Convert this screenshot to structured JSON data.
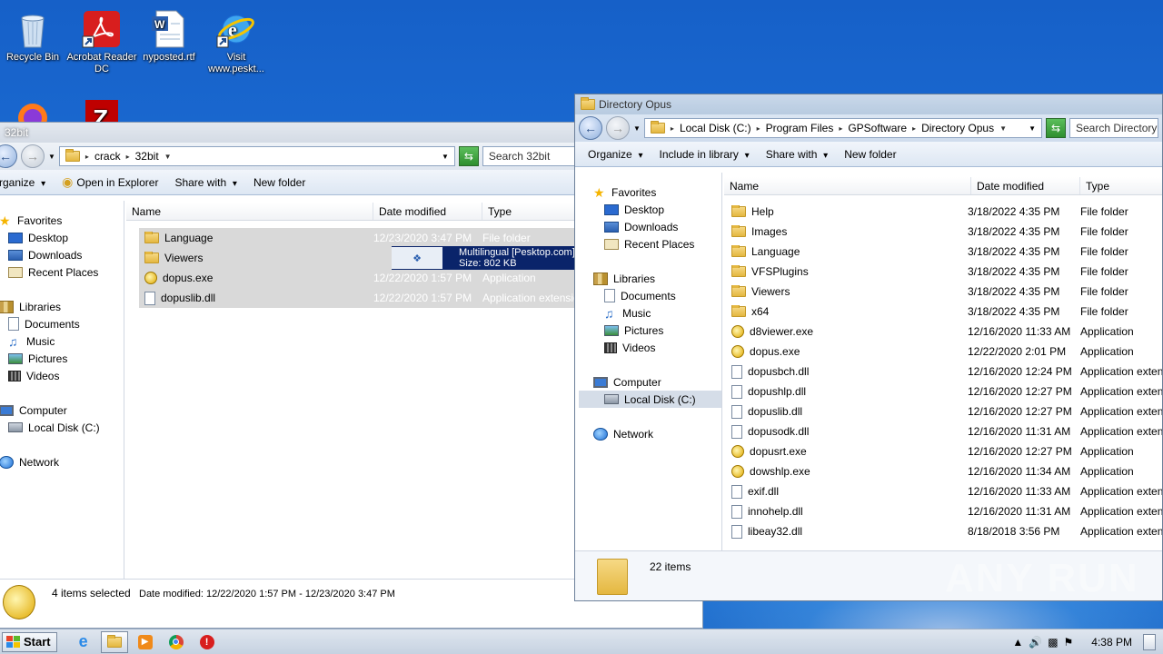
{
  "desktop": {
    "icons": [
      {
        "label": "Recycle Bin"
      },
      {
        "label": "Acrobat Reader DC"
      },
      {
        "label": "nyposted.rtf"
      },
      {
        "label": "Visit www.peskt..."
      }
    ]
  },
  "left_window": {
    "title": "32bit",
    "breadcrumb": [
      "crack",
      "32bit"
    ],
    "search_placeholder": "Search 32bit",
    "commands": {
      "organize": "rganize",
      "open": "Open in Explorer",
      "share": "Share with",
      "new_folder": "New folder"
    },
    "columns": {
      "name": "Name",
      "date": "Date modified",
      "type": "Type"
    },
    "nav": {
      "favorites": "Favorites",
      "desktop": "Desktop",
      "downloads": "Downloads",
      "recent": "Recent Places",
      "libraries": "Libraries",
      "documents": "Documents",
      "music": "Music",
      "pictures": "Pictures",
      "videos": "Videos",
      "computer": "Computer",
      "local_disk": "Local Disk (C:)",
      "network": "Network"
    },
    "files": [
      {
        "name": "Language",
        "date": "12/23/2020 3:47 PM",
        "type": "File folder",
        "icon": "folder"
      },
      {
        "name": "Viewers",
        "date": "",
        "type": "",
        "icon": "folder"
      },
      {
        "name": "dopus.exe",
        "date": "12/22/2020 1:57 PM",
        "type": "Application",
        "icon": "exe"
      },
      {
        "name": "dopuslib.dll",
        "date": "12/22/2020 1:57 PM",
        "type": "Application extensio",
        "icon": "dll"
      }
    ],
    "tooltip": {
      "line1": "Multilingual [Pesktop.com]",
      "line2": "Size: 802 KB"
    },
    "status": {
      "count": "4 items selected",
      "detail": "Date modified: 12/22/2020 1:57 PM - 12/23/2020 3:47 PM"
    }
  },
  "right_window": {
    "title": "Directory Opus",
    "breadcrumb": [
      "Local Disk (C:)",
      "Program Files",
      "GPSoftware",
      "Directory Opus"
    ],
    "search_placeholder": "Search Directory O",
    "commands": {
      "organize": "Organize",
      "include": "Include in library",
      "share": "Share with",
      "new_folder": "New folder"
    },
    "columns": {
      "name": "Name",
      "date": "Date modified",
      "type": "Type"
    },
    "nav": {
      "favorites": "Favorites",
      "desktop": "Desktop",
      "downloads": "Downloads",
      "recent": "Recent Places",
      "libraries": "Libraries",
      "documents": "Documents",
      "music": "Music",
      "pictures": "Pictures",
      "videos": "Videos",
      "computer": "Computer",
      "local_disk": "Local Disk (C:)",
      "network": "Network"
    },
    "files": [
      {
        "name": "Help",
        "date": "3/18/2022 4:35 PM",
        "type": "File folder",
        "icon": "folder"
      },
      {
        "name": "Images",
        "date": "3/18/2022 4:35 PM",
        "type": "File folder",
        "icon": "folder"
      },
      {
        "name": "Language",
        "date": "3/18/2022 4:35 PM",
        "type": "File folder",
        "icon": "folder"
      },
      {
        "name": "VFSPlugins",
        "date": "3/18/2022 4:35 PM",
        "type": "File folder",
        "icon": "folder"
      },
      {
        "name": "Viewers",
        "date": "3/18/2022 4:35 PM",
        "type": "File folder",
        "icon": "folder"
      },
      {
        "name": "x64",
        "date": "3/18/2022 4:35 PM",
        "type": "File folder",
        "icon": "folder"
      },
      {
        "name": "d8viewer.exe",
        "date": "12/16/2020 11:33 AM",
        "type": "Application",
        "icon": "exe"
      },
      {
        "name": "dopus.exe",
        "date": "12/22/2020 2:01 PM",
        "type": "Application",
        "icon": "exe"
      },
      {
        "name": "dopusbch.dll",
        "date": "12/16/2020 12:24 PM",
        "type": "Application extens",
        "icon": "dll"
      },
      {
        "name": "dopushlp.dll",
        "date": "12/16/2020 12:27 PM",
        "type": "Application extens",
        "icon": "dll"
      },
      {
        "name": "dopuslib.dll",
        "date": "12/16/2020 12:27 PM",
        "type": "Application extens",
        "icon": "dll"
      },
      {
        "name": "dopusodk.dll",
        "date": "12/16/2020 11:31 AM",
        "type": "Application extens",
        "icon": "dll"
      },
      {
        "name": "dopusrt.exe",
        "date": "12/16/2020 12:27 PM",
        "type": "Application",
        "icon": "exe"
      },
      {
        "name": "dowshlp.exe",
        "date": "12/16/2020 11:34 AM",
        "type": "Application",
        "icon": "exe"
      },
      {
        "name": "exif.dll",
        "date": "12/16/2020 11:33 AM",
        "type": "Application extens",
        "icon": "dll"
      },
      {
        "name": "innohelp.dll",
        "date": "12/16/2020 11:31 AM",
        "type": "Application extens",
        "icon": "dll"
      },
      {
        "name": "libeay32.dll",
        "date": "8/18/2018 3:56 PM",
        "type": "Application extens",
        "icon": "dll"
      }
    ],
    "status": {
      "count": "22 items"
    }
  },
  "taskbar": {
    "start_label": "Start",
    "clock": "4:38 PM"
  },
  "watermark": "ANY RUN"
}
